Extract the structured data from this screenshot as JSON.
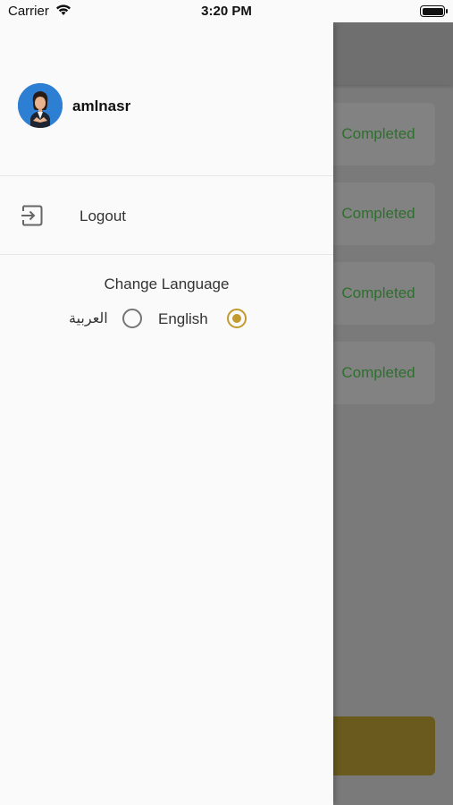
{
  "status_bar": {
    "carrier": "Carrier",
    "time": "3:20 PM"
  },
  "background": {
    "cards": [
      {
        "status": "Completed"
      },
      {
        "status": "Completed"
      },
      {
        "status": "Completed"
      },
      {
        "status": "Completed"
      }
    ],
    "status_color": "#2f6f2f",
    "button_color": "#6a5a1e"
  },
  "drawer": {
    "user": {
      "name": "amlnasr",
      "avatar": "user-avatar"
    },
    "logout": {
      "label": "Logout",
      "icon": "logout-icon"
    },
    "language": {
      "title": "Change Language",
      "options": [
        {
          "label": "العربية",
          "selected": false
        },
        {
          "label": "English",
          "selected": true
        }
      ],
      "accent_color": "#c39a2d"
    }
  }
}
